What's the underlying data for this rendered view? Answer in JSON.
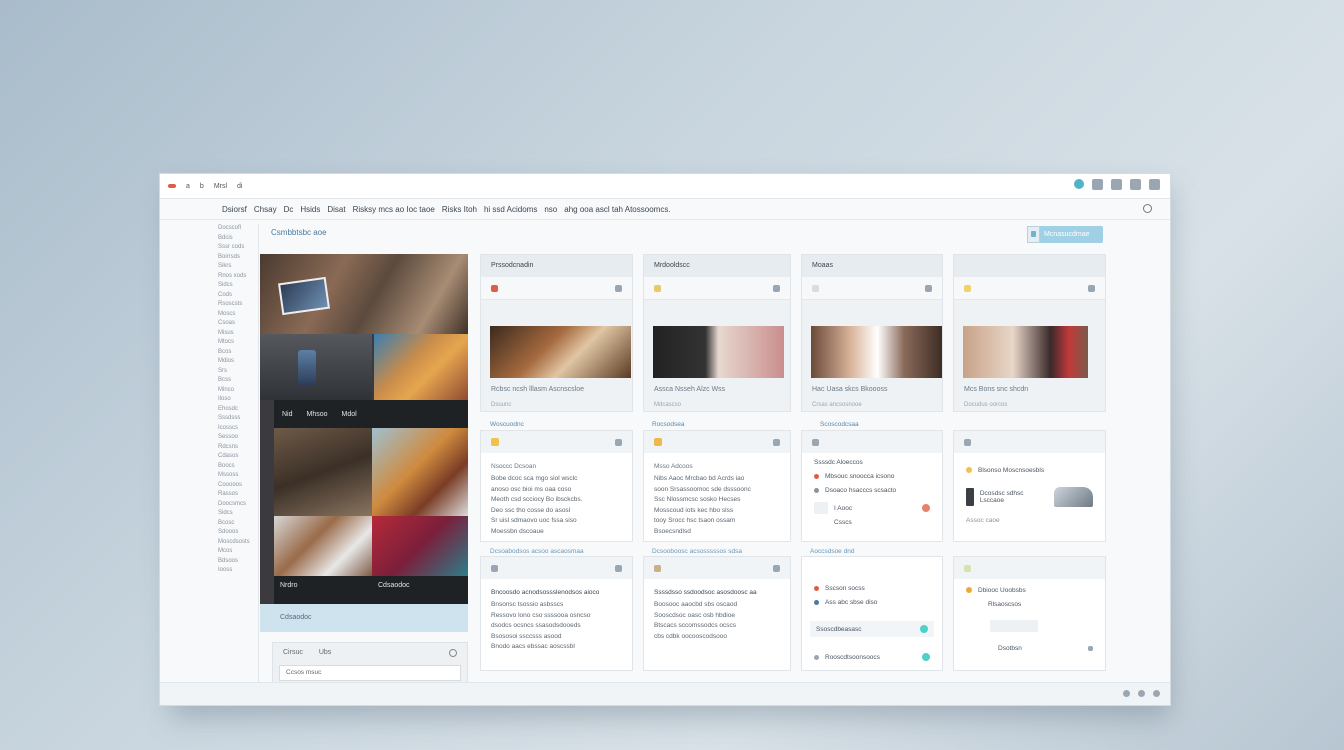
{
  "titlebar": {
    "left_items": [
      "a",
      "b",
      "Mrsl",
      "di"
    ],
    "right_items": [
      "dz",
      "eg",
      "ol",
      "tf"
    ]
  },
  "menu": {
    "items": [
      "Dsiorsf",
      "Chsay",
      "Dc",
      "Hsids",
      "Disat",
      "Risksy mcs ao Ioc taoe",
      "Risks Itoh",
      "hi ssd Acidoms",
      "nso",
      "ahg ooa ascl tah Atossoomcs."
    ]
  },
  "sidebar": {
    "items": [
      "Docscofl",
      "Bdcis",
      "Sssr cods",
      "Boirrsds",
      "Sikrs",
      "Rnos xods",
      "Sidcs",
      "Cods",
      "Rsoscsts",
      "Moscs",
      "Csoas",
      "Misus",
      "Mtocs",
      "Bcos",
      "Mdios",
      "Srs",
      "Bcss",
      "Minco",
      "Iloso",
      "Ehosdc",
      "Sssdsss",
      "Icosscs",
      "Sessoo",
      "Rdcsns",
      "Cdasos",
      "Boocs",
      "Mssoss",
      "Cooooos",
      "Rassos",
      "Doocsmcs",
      "Sidcs",
      "Bcosc",
      "Sdooos",
      "Moscdsosts",
      "Mcos",
      "Bdsoos",
      "Iooss"
    ]
  },
  "crumb": "Csmbbtsbc aoe",
  "top_button": "Mcnasucdmae",
  "gallery": {
    "header": [
      "Nid",
      "Mhsoo",
      "Mdol"
    ],
    "caption": "Nrdro",
    "footer_label": "Cdsaodoc",
    "input_labels": [
      "Cirsuc",
      "Ubs"
    ],
    "input_value": "Ccsos msuc"
  },
  "cards": [
    {
      "title": "Prssodcnadin",
      "caption": "Rcbsc ncsh lllasm Ascnscsloe",
      "sub": "Dsuunc"
    },
    {
      "title": "Mrdooldscc",
      "caption": "Assca Nsseh Alzc Wss",
      "sub": "Mdcascso"
    },
    {
      "title": "Moaas",
      "caption": "Hac Uasa skcs Bkoooss",
      "sub": "Crsas ancsosnooe"
    },
    {
      "title": "",
      "caption": "Mcs Bons snc shcdn",
      "sub": "Docudus oorcos"
    }
  ],
  "mid_labels": [
    "Woscuodnc",
    "Rocsodsea",
    "Scoscodcsaa"
  ],
  "text_cards": [
    {
      "head": "Nsoccc Dcsoan",
      "lines": [
        "Bobe dcoc sca mgo siol wsclc",
        "anoso osc bioi ms oaa coso",
        "Meoth csd scciocy Bo ibsckcbs.",
        "Deo ssc tho cosse do asosl",
        "Sr uisl sdmaovo uoc fssa siso",
        "Moessbn dscoaue"
      ]
    },
    {
      "head": "Msso Adcoos",
      "lines": [
        "Nibs Aaoc Mrcbao bd Acrds iao",
        "soon Srsassoomoc sde dsssoonc",
        "Ssc Nlossmcsc sosko Hecses",
        "Mosscoud iots kec hbo slss",
        "tooy Srocc hsc tsaon ossam",
        "Bsoecsndlsd"
      ]
    }
  ],
  "mid_card": {
    "head": "Ssssdc Aloeccos",
    "rows": [
      "Mbsouc snoocca icsono",
      "Dsoaco hsacccs scsacto",
      "I Aooc",
      "Csscs"
    ]
  },
  "right_card": {
    "head": "Blsonso Moscnsoesbls",
    "row": "Dcosdsc sdhsc Lsccaoe",
    "row2": "Assoc caoe"
  },
  "bottom_labels": [
    "Dcsoabodsos acsoo ascaosmaa",
    "Dcsooboosc acsosssssos sdsa",
    "Aoccsdsoe dnd"
  ],
  "bottom_cards": [
    {
      "head": "Bncoosdo acnodsossslenodsos aioco",
      "lines": [
        "Bnsonsc tsossio asbsscs",
        "Ressovo lono cso ssssooa osncso",
        "dsodcs ocsncs ssasodsdooeds",
        "Bsososoi ssccsss asood",
        "Bnodo aacs ebssac aoscssbl"
      ]
    },
    {
      "head": "Ssssdsso ssdoodsoc asosdoosc aa",
      "lines": [
        "Boosooc aaocbd sbs oscaod",
        "Sooscdsoc oasc osb hbdioe",
        "Btscacs sccomssodcs ocscs",
        "cbs cdbk oocooscodsooo"
      ]
    }
  ],
  "bottom_mid": {
    "lines": [
      "Sscson socss",
      "Ass abc sbse diso"
    ],
    "btn1": "Ssoscdbeasasc",
    "btn2": "Rooscdtsoonsoocs"
  },
  "bottom_right": {
    "lines": [
      "Dbiooc Uoobsbs",
      "Rlsaoscsos"
    ],
    "btn": "Dsotbsn"
  },
  "colors": {
    "accent": "#4fb4c7",
    "danger": "#e15c48",
    "link": "#4a7aa0"
  }
}
